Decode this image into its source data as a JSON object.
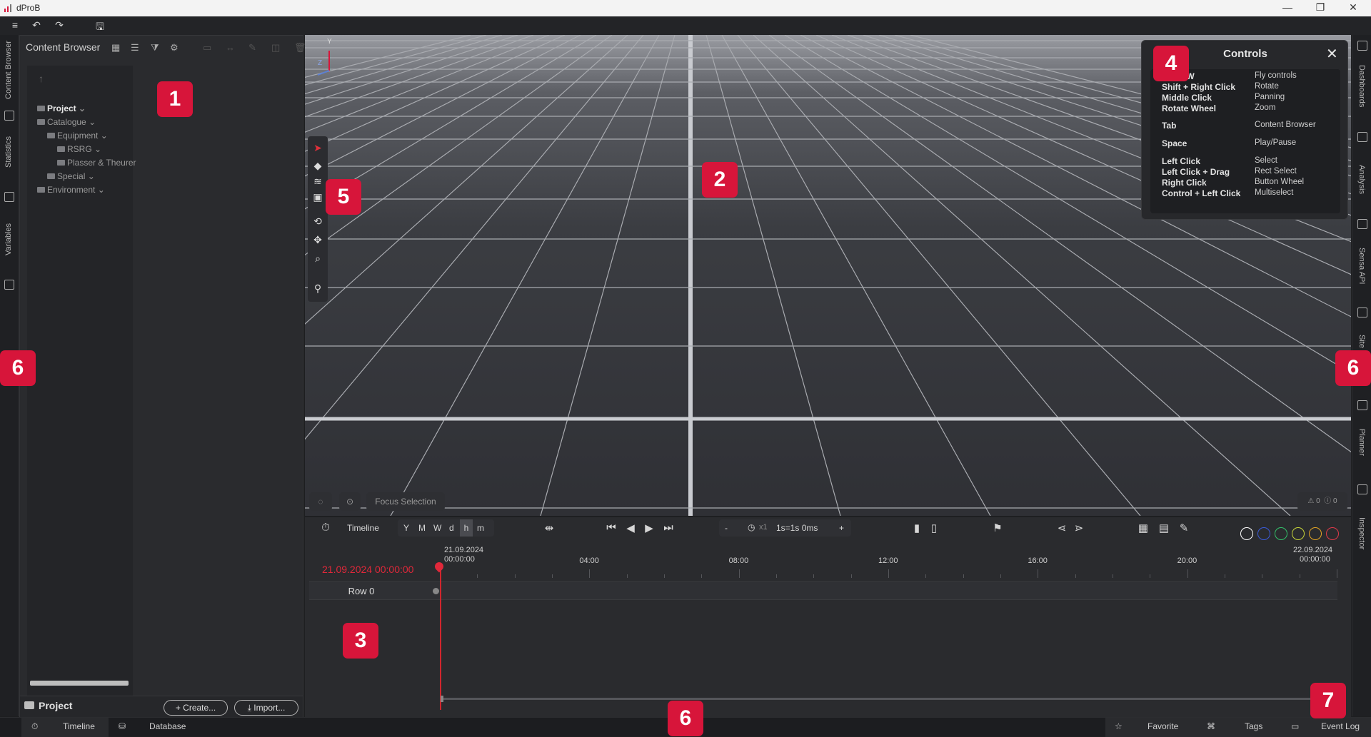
{
  "app": {
    "title": "dProB"
  },
  "window_controls": {
    "minimize": "—",
    "maximize": "❐",
    "close": "✕"
  },
  "toolbar": {
    "menu": "≡",
    "undo": "↶",
    "redo": "↷",
    "save": "🖫"
  },
  "left_rail": {
    "tabs": [
      "Content Browser",
      "Statistics",
      "Variables"
    ]
  },
  "right_rail": {
    "tabs": [
      "Dashboards",
      "Analysis",
      "Sensa API",
      "Site",
      "Planner",
      "Inspector"
    ]
  },
  "content_browser": {
    "title": "Content Browser",
    "up": "↑",
    "tree": [
      {
        "label": "Project",
        "level": 0,
        "bold": true,
        "chevron": "⌄"
      },
      {
        "label": "Catalogue",
        "level": 0,
        "chevron": "⌄"
      },
      {
        "label": "Equipment",
        "level": 1,
        "chevron": "⌄"
      },
      {
        "label": "RSRG",
        "level": 2,
        "chevron": "⌄"
      },
      {
        "label": "Plasser & Theurer",
        "level": 2,
        "chevron": ""
      },
      {
        "label": "Special",
        "level": 1,
        "chevron": "⌄"
      },
      {
        "label": "Environment",
        "level": 0,
        "chevron": "⌄"
      }
    ],
    "footer": {
      "project": "Project",
      "create": "+ Create...",
      "import": "⤓ Import..."
    }
  },
  "controls": {
    "title": "Controls",
    "close": "✕",
    "rows": [
      {
        "key": "Ctrl + W",
        "value": "Fly controls"
      },
      {
        "key": "Shift + Right Click",
        "value": "Rotate"
      },
      {
        "key": "Middle Click",
        "value": "Panning"
      },
      {
        "key": "Rotate Wheel",
        "value": "Zoom"
      },
      {
        "key": "Tab",
        "value": "Content Browser"
      },
      {
        "key": "Space",
        "value": "Play/Pause"
      },
      {
        "key": "Left Click",
        "value": "Select"
      },
      {
        "key": "Left Click + Drag",
        "value": "Rect Select"
      },
      {
        "key": "Right Click",
        "value": "Button Wheel"
      },
      {
        "key": "Control + Left Click",
        "value": "Multiselect"
      }
    ]
  },
  "viewport": {
    "axis_y": "Y",
    "axis_z": "Z",
    "focus_selection": "Focus Selection",
    "warnings": "0",
    "errors": "0"
  },
  "timeline": {
    "label": "Timeline",
    "scales": [
      "Y",
      "M",
      "W",
      "d",
      "h",
      "m"
    ],
    "active_scale": "h",
    "speed_minus": "-",
    "speed_multiplier": "x1",
    "speed": "1s=1s 0ms",
    "speed_plus": "+",
    "start_date": "21.09.2024",
    "start_time": "00:00:00",
    "end_date": "22.09.2024",
    "end_time": "00:00:00",
    "current": "21.09.2024 00:00:00",
    "ticks": [
      "04:00",
      "08:00",
      "12:00",
      "16:00",
      "20:00"
    ],
    "row": "Row 0",
    "filter_colors": [
      "#ffffff",
      "#3b5bd9",
      "#33c06a",
      "#c7d63a",
      "#e3a524",
      "#e03a4a"
    ]
  },
  "bottom_bar": {
    "left_tabs": [
      "Timeline",
      "Database"
    ],
    "right_tabs": [
      "Favorite",
      "Tags",
      "Event Log"
    ]
  },
  "markers": [
    "1",
    "2",
    "3",
    "4",
    "5",
    "6",
    "6",
    "6",
    "7"
  ]
}
